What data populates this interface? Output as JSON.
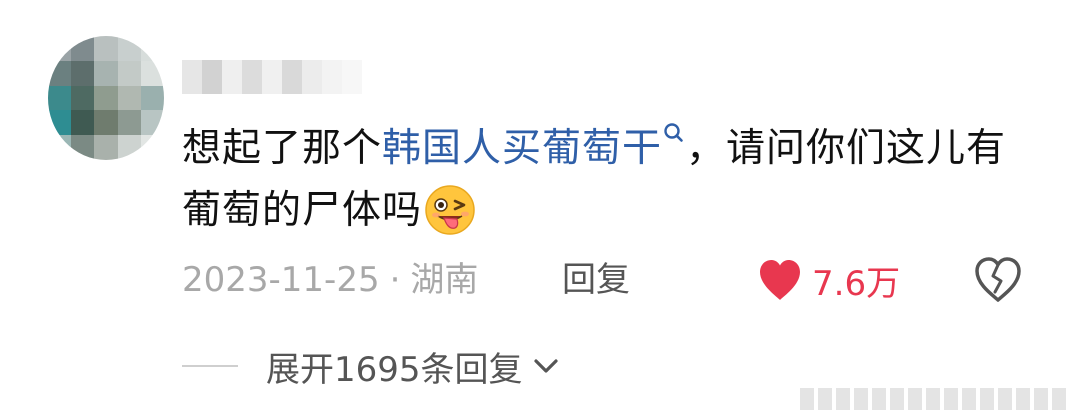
{
  "comment": {
    "avatar_label": "avatar",
    "text_before": "想起了那个",
    "topic_link": "韩国人买葡萄干",
    "text_after": "，请问你们这儿有葡萄的尸体吗",
    "emoji": "wink-tongue-emoji"
  },
  "meta": {
    "date": "2023-11-25",
    "separator": "·",
    "location": "湖南",
    "reply_label": "回复",
    "like_count": "7.6万",
    "like_icon": "heart-icon",
    "dislike_icon": "broken-heart-icon"
  },
  "expand": {
    "label": "展开1695条回复",
    "icon": "chevron-down-icon"
  },
  "colors": {
    "topic": "#2f5fa8",
    "like": "#e8374f",
    "meta": "#a8a8a8",
    "reply": "#555555"
  }
}
